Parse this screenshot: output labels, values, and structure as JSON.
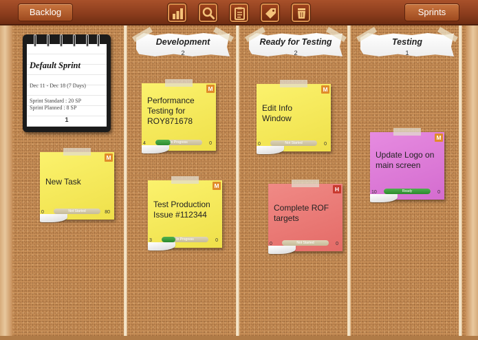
{
  "topbar": {
    "backlog_label": "Backlog",
    "sprints_label": "Sprints",
    "tools": [
      "chart-icon",
      "search-icon",
      "clipboard-icon",
      "tag-icon",
      "trash-icon"
    ]
  },
  "sprint": {
    "name": "Default Sprint",
    "dates": "Dec 11 - Dec 18  (7 Days)",
    "standard": "Sprint Standard : 20 SP",
    "planned": "Sprint Planned : 8 SP",
    "number": "1"
  },
  "columns": [
    {
      "title": "Development",
      "count": "2"
    },
    {
      "title": "Ready for Testing",
      "count": "2"
    },
    {
      "title": "Testing",
      "count": "1"
    }
  ],
  "notes": [
    {
      "task": "New Task",
      "priority": "M",
      "left": "0",
      "right": "80",
      "status": "Not Started",
      "progress": 0
    },
    {
      "task": "Performance Testing for ROY871678",
      "priority": "M",
      "left": "4",
      "right": "0",
      "status": "In Progress",
      "progress": 0.33
    },
    {
      "task": "Test Production Issue #112344",
      "priority": "M",
      "left": "3",
      "right": "0",
      "status": "In Progress",
      "progress": 0.3
    },
    {
      "task": "Edit Info Window",
      "priority": "M",
      "left": "0",
      "right": "0",
      "status": "Not Started",
      "progress": 0
    },
    {
      "task": "Complete ROF targets",
      "priority": "H",
      "left": "0",
      "right": "0",
      "status": "Not Started",
      "progress": 0
    },
    {
      "task": "Update Logo on main screen",
      "priority": "M",
      "left": "10",
      "right": "0",
      "status": "Ready",
      "progress": 1
    }
  ],
  "colors": {
    "note_yellow": "#fbf26d",
    "note_red": "#f08a86",
    "note_pink": "#e68be0",
    "progress_green": "#2c8a2c",
    "priority_medium": "#e08c2a",
    "priority_high": "#c8392f"
  }
}
